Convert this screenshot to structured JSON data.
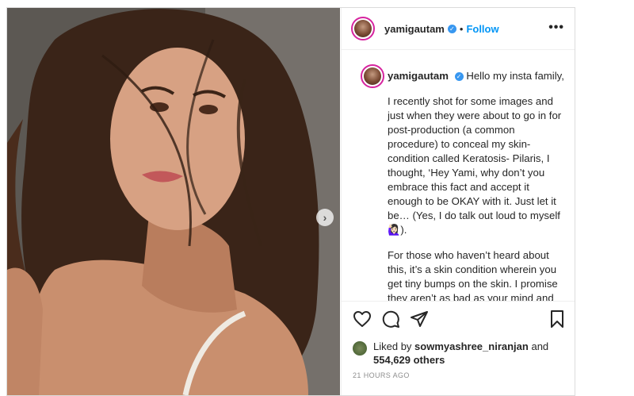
{
  "post": {
    "username": "yamigautam",
    "verified_mark": "✓",
    "separator": "•",
    "follow_label": "Follow",
    "more_label": "•••",
    "carousel_next": "›"
  },
  "caption": {
    "username": "yamigautam",
    "greeting": "Hello my insta family,",
    "paragraph1": "I recently shot for some images and just when they were about to go in for post-production (a common procedure) to conceal my skin-condition called Keratosis- Pilaris, I thought, ‘Hey Yami, why don’t you embrace this fact and accept it enough to be OKAY with it. Just let it be… (Yes, I do talk out loud to myself🙋🏻‍♀️).",
    "paragraph2": "For those who haven’t heard about this, it’s a skin condition wherein you get tiny bumps on the skin. I promise they aren’t as bad as your mind and your neighbor aunty makes it out to be 🤷🏻‍♀️🙆🏻‍♀️) I developed this skin condition during my"
  },
  "actions": {
    "like_icon": "heart-icon",
    "comment_icon": "comment-icon",
    "share_icon": "paper-plane-icon",
    "save_icon": "bookmark-icon"
  },
  "likes": {
    "prefix": "Liked by",
    "liker": "sowmyashree_niranjan",
    "connector": "and",
    "count": "554,629 others"
  },
  "timestamp": "21 HOURS AGO",
  "colors": {
    "accent": "#0095f6",
    "verified": "#3897f0",
    "text": "#262626",
    "muted": "#8e8e8e",
    "border": "#dbdbdb"
  }
}
